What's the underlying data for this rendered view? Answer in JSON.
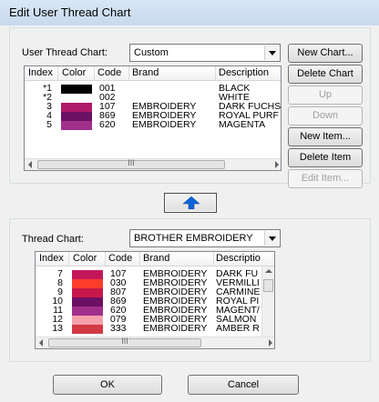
{
  "window": {
    "title": "Edit User Thread Chart"
  },
  "user_chart": {
    "label": "User Thread Chart:",
    "selected": "Custom",
    "columns": [
      "Index",
      "Color",
      "Code",
      "Brand",
      "Description"
    ],
    "rows": [
      {
        "index": "*1",
        "color": "#000000",
        "code": "001",
        "brand": "",
        "description": "BLACK"
      },
      {
        "index": "*2",
        "color": "#ffffff",
        "code": "002",
        "brand": "",
        "description": "WHITE"
      },
      {
        "index": "3",
        "color": "#b0186a",
        "code": "107",
        "brand": "EMBROIDERY",
        "description": "DARK FUCHS"
      },
      {
        "index": "4",
        "color": "#6c1063",
        "code": "869",
        "brand": "EMBROIDERY",
        "description": "ROYAL PURF"
      },
      {
        "index": "5",
        "color": "#a0308c",
        "code": "620",
        "brand": "EMBROIDERY",
        "description": "MAGENTA"
      }
    ],
    "scroll_thumb_label": "III"
  },
  "side_buttons": {
    "new_chart": "New Chart...",
    "delete_chart": "Delete Chart",
    "up": "Up",
    "down": "Down",
    "new_item": "New Item...",
    "delete_item": "Delete Item",
    "edit_item": "Edit Item..."
  },
  "thread_chart": {
    "label": "Thread Chart:",
    "selected": "BROTHER EMBROIDERY",
    "columns": [
      "Index",
      "Color",
      "Code",
      "Brand",
      "Descriptio"
    ],
    "rows": [
      {
        "index": "7",
        "color": "#c2185b",
        "code": "107",
        "brand": "EMBROIDERY",
        "description": "DARK FU"
      },
      {
        "index": "8",
        "color": "#ff3d2a",
        "code": "030",
        "brand": "EMBROIDERY",
        "description": "VERMILLI"
      },
      {
        "index": "9",
        "color": "#c8184a",
        "code": "807",
        "brand": "EMBROIDERY",
        "description": "CARMINE"
      },
      {
        "index": "10",
        "color": "#6c1063",
        "code": "869",
        "brand": "EMBROIDERY",
        "description": "ROYAL PI"
      },
      {
        "index": "11",
        "color": "#a0308c",
        "code": "620",
        "brand": "EMBROIDERY",
        "description": "MAGENT/"
      },
      {
        "index": "12",
        "color": "#f6a0ab",
        "code": "079",
        "brand": "EMBROIDERY",
        "description": "SALMON"
      },
      {
        "index": "13",
        "color": "#d23a45",
        "code": "333",
        "brand": "EMBROIDERY",
        "description": "AMBER R"
      }
    ],
    "scroll_thumb_label": "III"
  },
  "footer": {
    "ok": "OK",
    "cancel": "Cancel"
  },
  "icons": {
    "transfer_up": "up-arrow-icon"
  },
  "colors": {
    "accent": "#0a64d8",
    "title_bar": "#c7d9ee"
  }
}
